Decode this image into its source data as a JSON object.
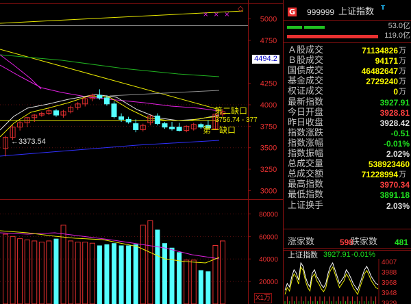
{
  "header": {
    "g_tag": "G",
    "code": "999999",
    "name": "上证指数",
    "name_mark": "T",
    "top_right_icon": "◇",
    "x_marks": "× × ×"
  },
  "vol_bars": [
    {
      "value": "53.0亿",
      "color": "#20c020"
    },
    {
      "value": "119.0亿",
      "color": "#e83030"
    }
  ],
  "stats": [
    {
      "label": "Ａ股成交",
      "value": "71134826",
      "unit": "万",
      "color": "#ffff00"
    },
    {
      "label": "Ｂ股成交",
      "value": "94171",
      "unit": "万",
      "color": "#ffff00"
    },
    {
      "label": "国债成交",
      "value": "46482647",
      "unit": "万",
      "color": "#ffff00"
    },
    {
      "label": "基金成交",
      "value": "2729240",
      "unit": "万",
      "color": "#ffff00"
    },
    {
      "label": "权证成交",
      "value": "0",
      "unit": "万",
      "color": "#ffff00"
    },
    {
      "label": "最新指数",
      "value": "3927.91",
      "unit": "",
      "color": "#20e020"
    },
    {
      "label": "今日开盘",
      "value": "3928.81",
      "unit": "",
      "color": "#ff4040"
    },
    {
      "label": "昨日收盘",
      "value": "3928.42",
      "unit": "",
      "color": "#e0e0e0"
    },
    {
      "label": "指数涨跌",
      "value": "-0.51",
      "unit": "",
      "color": "#20e020"
    },
    {
      "label": "指数涨幅",
      "value": "-0.01%",
      "unit": "",
      "color": "#20e020"
    },
    {
      "label": "指数振幅",
      "value": "2.02%",
      "unit": "",
      "color": "#e0e0e0"
    },
    {
      "label": "总成交量",
      "value": "538923460",
      "unit": "",
      "color": "#ffff00"
    },
    {
      "label": "总成交额",
      "value": "71228994",
      "unit": "万",
      "color": "#ffff00"
    },
    {
      "label": "最高指数",
      "value": "3970.34",
      "unit": "",
      "color": "#ff4040"
    },
    {
      "label": "最低指数",
      "value": "3891.18",
      "unit": "",
      "color": "#20e020"
    },
    {
      "label": "上证换手",
      "value": "2.03%",
      "unit": "",
      "color": "#e0e0e0"
    }
  ],
  "breadth": {
    "up_label": "涨家数",
    "up_value": "598",
    "down_label": "跌家数",
    "down_value": "481"
  },
  "mini": {
    "title": "上证指数",
    "value": "3927.91",
    "pct": "-0.01%",
    "axis": [
      "4007",
      "3988",
      "3968",
      "3948",
      "3929"
    ]
  },
  "price_axis": {
    "ticks": [
      {
        "text": "5000",
        "value": 5000
      },
      {
        "text": "4750",
        "value": 4750
      },
      {
        "text": "4250",
        "value": 4250
      },
      {
        "text": "4000",
        "value": 4000
      },
      {
        "text": "3750",
        "value": 3750
      },
      {
        "text": "3500",
        "value": 3500
      },
      {
        "text": "3250",
        "value": 3250
      },
      {
        "text": "3000",
        "value": 3000
      }
    ],
    "current_badge": "4494.2"
  },
  "vol_axis": {
    "ticks": [
      "80000",
      "60000",
      "40000",
      "20000"
    ],
    "unit": "X1万"
  },
  "annotations": {
    "low_label": "←3373.54",
    "gap1": "第一缺口",
    "gap2": "第二缺口",
    "range_label": "3756.74 - 377"
  },
  "colors": {
    "up": "#e83030",
    "down": "#54ffff",
    "ma_yellow": "#e8e800",
    "ma_white": "#e0e0e0",
    "ma_magenta": "#e020e0",
    "ma_green": "#20b020",
    "ma_blue": "#3030ff",
    "grid": "#8a1010"
  },
  "chart_data": {
    "type": "candlestick",
    "yrange": [
      2900,
      5180
    ],
    "candles": [
      {
        "o": 3490,
        "h": 3640,
        "l": 3400,
        "c": 3620
      },
      {
        "o": 3620,
        "h": 3760,
        "l": 3590,
        "c": 3740
      },
      {
        "o": 3740,
        "h": 3810,
        "l": 3700,
        "c": 3790
      },
      {
        "o": 3790,
        "h": 3860,
        "l": 3740,
        "c": 3850
      },
      {
        "o": 3850,
        "h": 3890,
        "l": 3800,
        "c": 3880
      },
      {
        "o": 3880,
        "h": 3920,
        "l": 3860,
        "c": 3900
      },
      {
        "o": 3900,
        "h": 3960,
        "l": 3880,
        "c": 3930
      },
      {
        "o": 3930,
        "h": 3950,
        "l": 3860,
        "c": 3880
      },
      {
        "o": 3880,
        "h": 3940,
        "l": 3850,
        "c": 3920
      },
      {
        "o": 3920,
        "h": 3990,
        "l": 3900,
        "c": 3970
      },
      {
        "o": 3970,
        "h": 4030,
        "l": 3940,
        "c": 4010
      },
      {
        "o": 4010,
        "h": 4090,
        "l": 3980,
        "c": 4070
      },
      {
        "o": 4070,
        "h": 4130,
        "l": 4040,
        "c": 4110
      },
      {
        "o": 4110,
        "h": 4180,
        "l": 4060,
        "c": 4080
      },
      {
        "o": 4080,
        "h": 4110,
        "l": 3990,
        "c": 4010
      },
      {
        "o": 4010,
        "h": 4040,
        "l": 3840,
        "c": 3860
      },
      {
        "o": 3860,
        "h": 3900,
        "l": 3800,
        "c": 3830
      },
      {
        "o": 3830,
        "h": 3860,
        "l": 3780,
        "c": 3800
      },
      {
        "o": 3780,
        "h": 3830,
        "l": 3680,
        "c": 3710
      },
      {
        "o": 3710,
        "h": 3780,
        "l": 3690,
        "c": 3760
      },
      {
        "o": 3790,
        "h": 3880,
        "l": 3760,
        "c": 3870
      },
      {
        "o": 3870,
        "h": 3900,
        "l": 3760,
        "c": 3780
      },
      {
        "o": 3780,
        "h": 3800,
        "l": 3720,
        "c": 3740
      },
      {
        "o": 3740,
        "h": 3800,
        "l": 3700,
        "c": 3720
      },
      {
        "o": 3740,
        "h": 3790,
        "l": 3690,
        "c": 3700
      },
      {
        "o": 3700,
        "h": 3760,
        "l": 3680,
        "c": 3750
      },
      {
        "o": 3720,
        "h": 3790,
        "l": 3700,
        "c": 3770
      },
      {
        "o": 3770,
        "h": 3790,
        "l": 3720,
        "c": 3740
      },
      {
        "o": 3760,
        "h": 3820,
        "l": 3720,
        "c": 3730
      },
      {
        "o": 3720,
        "h": 3900,
        "l": 3710,
        "c": 3890
      },
      {
        "o": 3890,
        "h": 3950,
        "l": 3860,
        "c": 3920
      }
    ],
    "volumes": [
      62000,
      60000,
      58000,
      57000,
      56000,
      55000,
      56000,
      58000,
      70000,
      56000,
      55000,
      55000,
      54000,
      52000,
      53000,
      54000,
      52000,
      52000,
      53000,
      70000,
      74000,
      66000,
      54000,
      50000,
      46000,
      39000,
      39000,
      30000,
      29000,
      52000,
      56000
    ],
    "volume_range": [
      0,
      90000
    ]
  }
}
